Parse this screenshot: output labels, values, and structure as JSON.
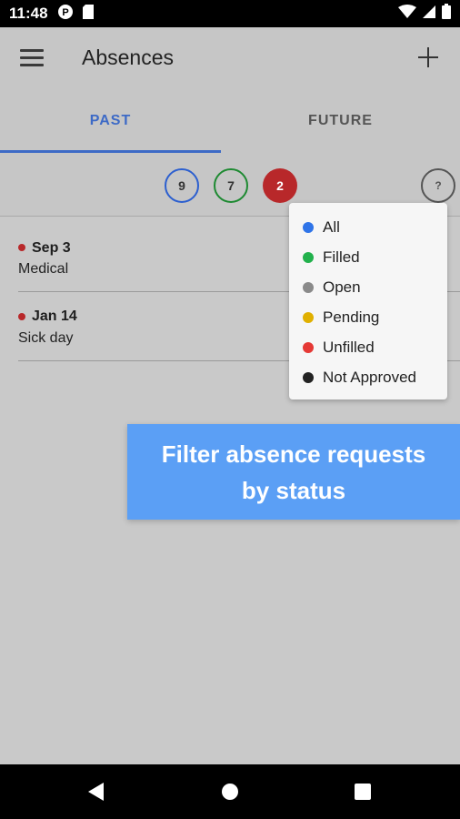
{
  "status_bar": {
    "time": "11:48"
  },
  "app_bar": {
    "title": "Absences"
  },
  "tabs": [
    {
      "label": "PAST",
      "selected": true
    },
    {
      "label": "FUTURE",
      "selected": false
    }
  ],
  "filters": {
    "all_count": "9",
    "filled_count": "7",
    "unfilled_count": "2",
    "help_label": "?"
  },
  "absences": [
    {
      "date": "Sep 3",
      "reason": "Medical",
      "status_color": "#b8282a"
    },
    {
      "date": "Jan 14",
      "reason": "Sick day",
      "status_color": "#b8282a"
    }
  ],
  "status_menu": [
    {
      "label": "All",
      "color": "#2f74e8"
    },
    {
      "label": "Filled",
      "color": "#22b14c"
    },
    {
      "label": "Open",
      "color": "#8a8a8a"
    },
    {
      "label": "Pending",
      "color": "#e0b000"
    },
    {
      "label": "Unfilled",
      "color": "#e53935"
    },
    {
      "label": "Not Approved",
      "color": "#222222"
    }
  ],
  "callout": {
    "line1": "Filter absence requests",
    "line2": "by status"
  },
  "colors": {
    "accent": "#3d6ac6",
    "callout_bg": "#5b9ff5"
  }
}
